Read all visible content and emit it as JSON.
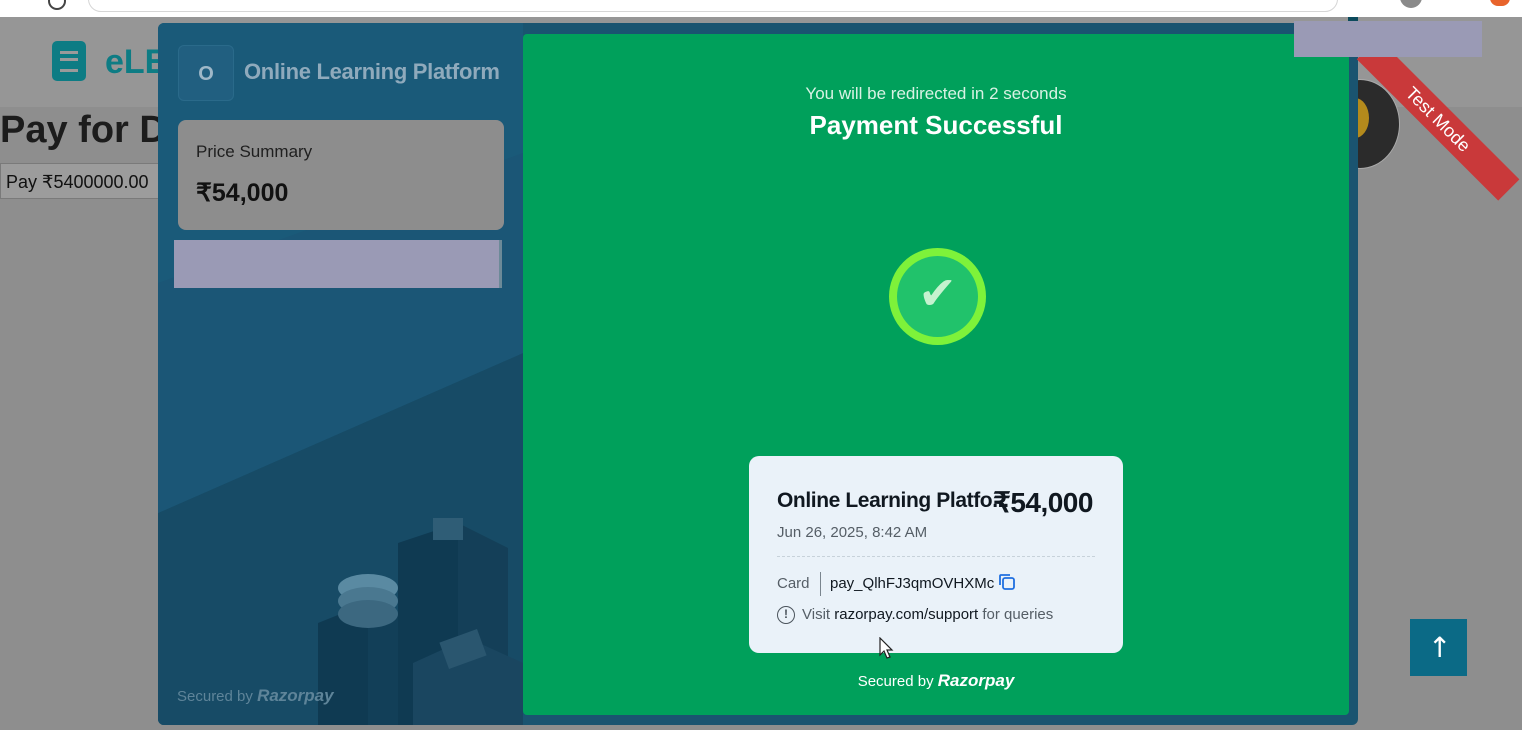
{
  "site": {
    "logo_text": "eLE",
    "page_title": "Pay for D",
    "pay_button_label": "Pay ₹5400000.00",
    "test_mode_label": "Test Mode",
    "scroll_top_icon": "↑"
  },
  "modal": {
    "merchant_initial": "O",
    "merchant_name": "Online Learning Platform",
    "price_summary_label": "Price Summary",
    "price_summary_value": "₹54,000",
    "secured_by_label": "Secured by",
    "brand_name": "Razorpay"
  },
  "success": {
    "redirect_text": "You will be redirected in 2 seconds",
    "title": "Payment Successful",
    "check_icon": "✔",
    "receipt": {
      "merchant": "Online Learning Platfo...",
      "amount": "₹54,000",
      "date": "Jun 26, 2025, 8:42 AM",
      "method": "Card",
      "payment_id": "pay_QlhFJ3qmOVHXMc",
      "support_prefix": "Visit",
      "support_link": "razorpay.com/support",
      "support_suffix": "for queries"
    },
    "secured_by_label": "Secured by",
    "brand_name": "Razorpay"
  },
  "colors": {
    "success_green": "#00a05b",
    "panel_blue": "#1a5a79",
    "check_ring": "#7ef23a",
    "brand_teal": "#0d7c84"
  }
}
